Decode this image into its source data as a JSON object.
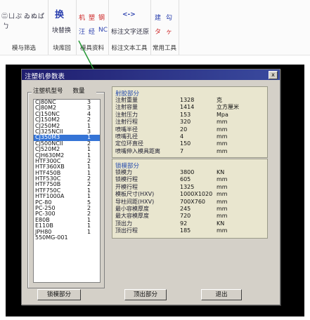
{
  "ribbon": {
    "group1": {
      "icon_chars": [
        "㊁",
        "ㄩ",
        "ぷ",
        "ゐ",
        "ぬ",
        "ぱ",
        "ㄅ"
      ],
      "label": "模与筛选"
    },
    "group2": {
      "big_char": "换",
      "line1": "块替换",
      "label": "块库回"
    },
    "group3": {
      "chars_row1": [
        "机",
        "塑",
        "钢"
      ],
      "chars_row2": [
        "汪",
        "经",
        "NC"
      ],
      "label": "模具资料"
    },
    "group4": {
      "icon_top": "<->",
      "line1": "标注文字还原",
      "label": "标注文本工具"
    },
    "group5": {
      "chars_row1": [
        "建",
        "勾"
      ],
      "chars_row2": [
        "タ",
        "ヶ"
      ],
      "label": "常用工具"
    },
    "accent_color": "#2a3fae",
    "red_color": "#cc2222"
  },
  "dialog": {
    "title": "注塑机参数表",
    "close_label": "x",
    "list_header": {
      "col_model": "注塑机型号",
      "col_qty": "数量"
    },
    "models": [
      {
        "name": "CJ80NC",
        "qty": "3"
      },
      {
        "name": "CJ80M2",
        "qty": "3"
      },
      {
        "name": "CJ150NC",
        "qty": "4"
      },
      {
        "name": "CJ150M2",
        "qty": "2"
      },
      {
        "name": "CJ250M2",
        "qty": "1"
      },
      {
        "name": "CJ325NCII",
        "qty": "3"
      },
      {
        "name": "CJ350M3",
        "qty": "1",
        "selected": true
      },
      {
        "name": "CJ500NCII",
        "qty": "2"
      },
      {
        "name": "CJ520M2",
        "qty": "1"
      },
      {
        "name": "CJH630M2",
        "qty": "1"
      },
      {
        "name": "HTF300C",
        "qty": "2"
      },
      {
        "name": "HTF360XB",
        "qty": "1"
      },
      {
        "name": "HTF450B",
        "qty": "1"
      },
      {
        "name": "HTF530C",
        "qty": "2"
      },
      {
        "name": "HTF750B",
        "qty": "2"
      },
      {
        "name": "HTF750C",
        "qty": "1"
      },
      {
        "name": "HTF1000A",
        "qty": "1"
      },
      {
        "name": "PC-80",
        "qty": "5"
      },
      {
        "name": "PC-250",
        "qty": "2"
      },
      {
        "name": "PC-300",
        "qty": "2"
      },
      {
        "name": "E80B",
        "qty": "1"
      },
      {
        "name": "E110B",
        "qty": "1"
      },
      {
        "name": "JPH80",
        "qty": "1"
      },
      {
        "name": "550MG-001",
        "qty": ""
      }
    ],
    "injection": {
      "title": "射胶部分",
      "rows": [
        {
          "label": "注射重量",
          "value": "1328",
          "unit": "克"
        },
        {
          "label": "注射容量",
          "value": "1414",
          "unit": "立方厘米"
        },
        {
          "label": "注射压力",
          "value": "153",
          "unit": "Mpa"
        },
        {
          "label": "注射行程",
          "value": "320",
          "unit": "mm"
        },
        {
          "label": "喷嘴半径",
          "value": "20",
          "unit": "mm"
        },
        {
          "label": "喷嘴孔径",
          "value": "4",
          "unit": "mm"
        },
        {
          "label": "定位环直径",
          "value": "150",
          "unit": "mm"
        },
        {
          "label": "喷嘴伸入模具距离",
          "value": "7",
          "unit": "mm"
        }
      ]
    },
    "clamping": {
      "title": "锁模部分",
      "rows": [
        {
          "label": "锁模力",
          "value": "3800",
          "unit": "KN"
        },
        {
          "label": "锁模行程",
          "value": "605",
          "unit": "mm"
        },
        {
          "label": "开模行程",
          "value": "1325",
          "unit": "mm"
        },
        {
          "label": "模板尺寸(HXV)",
          "value": "1000X1020",
          "unit": "mm"
        },
        {
          "label": "导柱间距(HXV)",
          "value": "700X760",
          "unit": "mm"
        },
        {
          "label": "最小容模厚度",
          "value": "245",
          "unit": "mm"
        },
        {
          "label": "最大容模厚度",
          "value": "720",
          "unit": "mm"
        },
        {
          "label": "顶出力",
          "value": "92",
          "unit": "KN"
        },
        {
          "label": "顶出行程",
          "value": "185",
          "unit": "mm"
        }
      ]
    },
    "buttons": {
      "clamp": "锁模部分",
      "eject": "顶出部分",
      "exit": "退出"
    }
  },
  "colors": {
    "titlebar": "#1f1d6e",
    "selection": "#3574d6",
    "panel_bg": "#e9e6cf",
    "arrow": "#2a9a3a"
  }
}
